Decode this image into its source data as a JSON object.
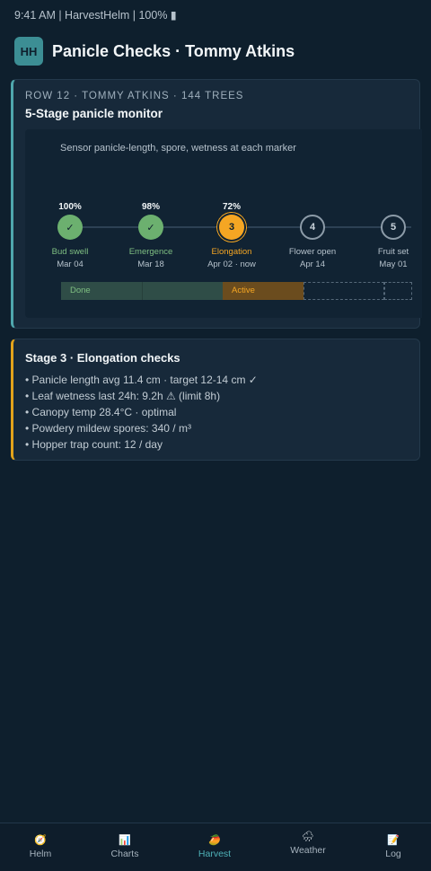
{
  "status_bar": "9:41 AM | HarvestHelm | 100% ▮",
  "header": {
    "logo": "HH",
    "title": "Panicle Checks · Tommy Atkins"
  },
  "monitor": {
    "eyebrow": "ROW 12 · TOMMY ATKINS · 144 TREES",
    "title": "5-Stage panicle monitor",
    "subtitle": "Sensor panicle-length, spore, wetness at each marker",
    "stages": [
      {
        "pct": "100%",
        "marker": "✓",
        "name": "Bud swell",
        "date": "Mar 04",
        "state": "done"
      },
      {
        "pct": "98%",
        "marker": "✓",
        "name": "Emergence",
        "date": "Mar 18",
        "state": "done"
      },
      {
        "pct": "72%",
        "marker": "3",
        "name": "Elongation",
        "date": "Apr 02 · now",
        "state": "active"
      },
      {
        "pct": "",
        "marker": "4",
        "name": "Flower open",
        "date": "Apr 14",
        "state": "todo"
      },
      {
        "pct": "",
        "marker": "5",
        "name": "Fruit set",
        "date": "May 01",
        "state": "todo"
      }
    ],
    "bar": {
      "done_label": "Done",
      "active_label": "Active"
    }
  },
  "checks": {
    "title": "Stage 3 · Elongation checks",
    "items": [
      "• Panicle length avg 11.4 cm · target 12-14 cm ✓",
      "• Leaf wetness last 24h: 9.2h ⚠ (limit 8h)",
      "• Canopy temp 28.4°C · optimal",
      "• Powdery mildew spores: 340 / m³",
      "• Hopper trap count: 12 / day"
    ]
  },
  "tabs": [
    {
      "icon": "🧭",
      "label": "Helm",
      "active": false
    },
    {
      "icon": "📊",
      "label": "Charts",
      "active": false
    },
    {
      "icon": "🥭",
      "label": "Harvest",
      "active": true
    },
    {
      "icon": "🌧",
      "label": "Weather",
      "active": false
    },
    {
      "icon": "📝",
      "label": "Log",
      "active": false
    }
  ],
  "colors": {
    "accent": "#4fa7ad",
    "active": "#f5a623",
    "done": "#6cb06f",
    "background": "#0e1f2d"
  }
}
